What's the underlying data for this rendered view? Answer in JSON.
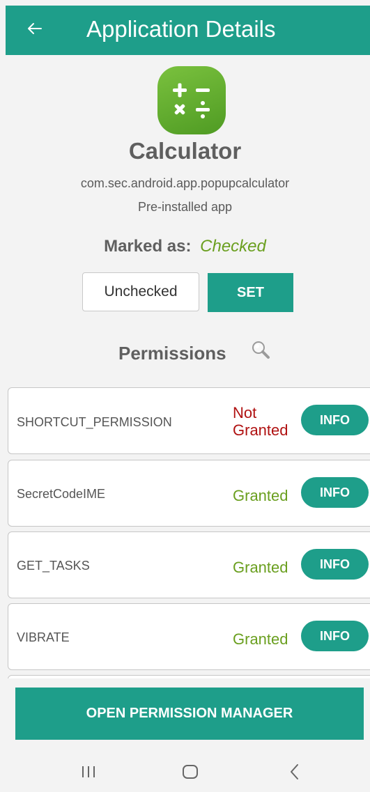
{
  "appbar": {
    "title": "Application Details",
    "back_icon": "arrow-left-icon"
  },
  "app": {
    "icon": "calculator-icon",
    "name": "Calculator",
    "package": "com.sec.android.app.popupcalculator",
    "install_type": "Pre-installed app"
  },
  "marked": {
    "label": "Marked as:",
    "value": "Checked"
  },
  "status_select": {
    "value": "Unchecked"
  },
  "set_label": "SET",
  "permissions": {
    "heading": "Permissions",
    "search_icon": "search-icon",
    "items": [
      {
        "name": "SHORTCUT_PERMISSION",
        "status_line1": "Not",
        "status_line2": "Granted",
        "info_label": "INFO"
      },
      {
        "name": "SecretCodeIME",
        "status": "Granted",
        "info_label": "INFO"
      },
      {
        "name": "GET_TASKS",
        "status": "Granted",
        "info_label": "INFO"
      },
      {
        "name": "VIBRATE",
        "status": "Granted",
        "info_label": "INFO"
      }
    ]
  },
  "open_permission_manager": "OPEN PERMISSION MANAGER",
  "navbar": {
    "recents_icon": "recents-icon",
    "home_icon": "home-icon",
    "back_icon": "nav-back-icon"
  },
  "colors": {
    "accent": "#1e9e8a",
    "granted": "#6a9f1f",
    "not_granted": "#b01212"
  }
}
